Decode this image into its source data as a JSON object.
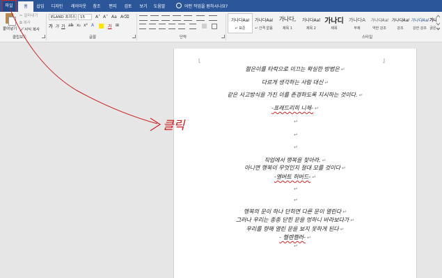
{
  "tabs": [
    "파일",
    "홈",
    "삽입",
    "디자인",
    "레이아웃",
    "참조",
    "편지",
    "검토",
    "보기",
    "도움말"
  ],
  "tell_me": "어떤 작업을 원하시나요?",
  "clipboard": {
    "paste": "붙여넣기",
    "cut": "잘라내기",
    "copy": "복사",
    "format_painter": "서식 복사",
    "label": "클립보드"
  },
  "font": {
    "name": "ELAND 초이스",
    "size": "15",
    "label": "글꼴",
    "bold": "가",
    "italic": "가",
    "underline": "가"
  },
  "paragraph": {
    "label": "단락"
  },
  "styles": {
    "label": "스타일",
    "items": [
      {
        "preview": "가나다AaI",
        "name": "↵ 표준"
      },
      {
        "preview": "가나다AaI",
        "name": "↵ 간격 없음"
      },
      {
        "preview": "가나다,",
        "name": "제목 1"
      },
      {
        "preview": "가나다Aal",
        "name": "제목 2"
      },
      {
        "preview": "가나디",
        "name": "제목"
      },
      {
        "preview": "가나다A",
        "name": "부제"
      },
      {
        "preview": "가나다AaI",
        "name": "약한 강조"
      },
      {
        "preview": "가나다AaI",
        "name": "강조"
      },
      {
        "preview": "가나다AaI",
        "name": "강한 강조"
      },
      {
        "preview": "가나다",
        "name": "굵은"
      }
    ]
  },
  "document": {
    "lines": [
      "젊은이를 타락으로 이끄는 확실한 방법은",
      "다르게 생각하는 사람 대신",
      "같은 사고방식을 가진 이를 존경하도록 지시하는 것이다.",
      "-프레드리히 니체-",
      "",
      "",
      "",
      "직업에서 행복을 찾아라.",
      "아니면 행복이 무엇인지 절대 모를 것이다",
      "-엘버트 허버드-",
      "",
      "",
      "행복의 문이 하나 단히면 다른 문이 열린다",
      "그러나 우리는 종종 닫힌 문을 멍하니 바라보다가",
      "우리를 향해 열린 문을 보지 못하게 된다",
      "- 헬렌켈러-",
      ""
    ]
  },
  "annotation": {
    "text": "클릭",
    "color": "#cc1f1f"
  }
}
